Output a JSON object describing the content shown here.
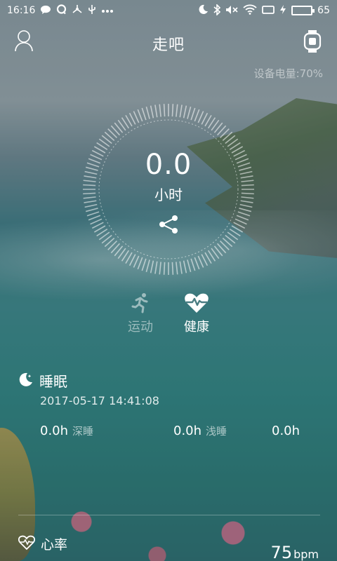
{
  "status_bar": {
    "time": "16:16",
    "battery_level": 65,
    "battery_text": "65",
    "left_icons": [
      "chat-bubble-icon",
      "qq-icon",
      "usb-icon",
      "usb-debug-icon",
      "more-dots-icon"
    ],
    "right_icons": [
      "moon-icon",
      "bluetooth-icon",
      "mute-icon",
      "wifi-icon",
      "screen-icon",
      "charging-icon",
      "battery-icon"
    ]
  },
  "header": {
    "title": "走吧"
  },
  "device": {
    "battery_label": "设备电量:70%"
  },
  "dial": {
    "value": "0.0",
    "unit": "小时"
  },
  "tabs": [
    {
      "label": "运动",
      "icon": "running-person-icon",
      "active": false
    },
    {
      "label": "健康",
      "icon": "heart-pulse-icon",
      "active": true
    }
  ],
  "sleep": {
    "title": "睡眠",
    "timestamp": "2017-05-17 14:41:08",
    "deep": {
      "value": "0.0h",
      "label": "深睡"
    },
    "light": {
      "value": "0.0h",
      "label": "浅睡"
    },
    "awake": {
      "value": "0.0h"
    }
  },
  "heart_rate": {
    "title": "心率",
    "value": "75",
    "unit": "bpm"
  },
  "colors": {
    "battery_fill": "#5ede3a",
    "text_primary": "#ffffff"
  }
}
